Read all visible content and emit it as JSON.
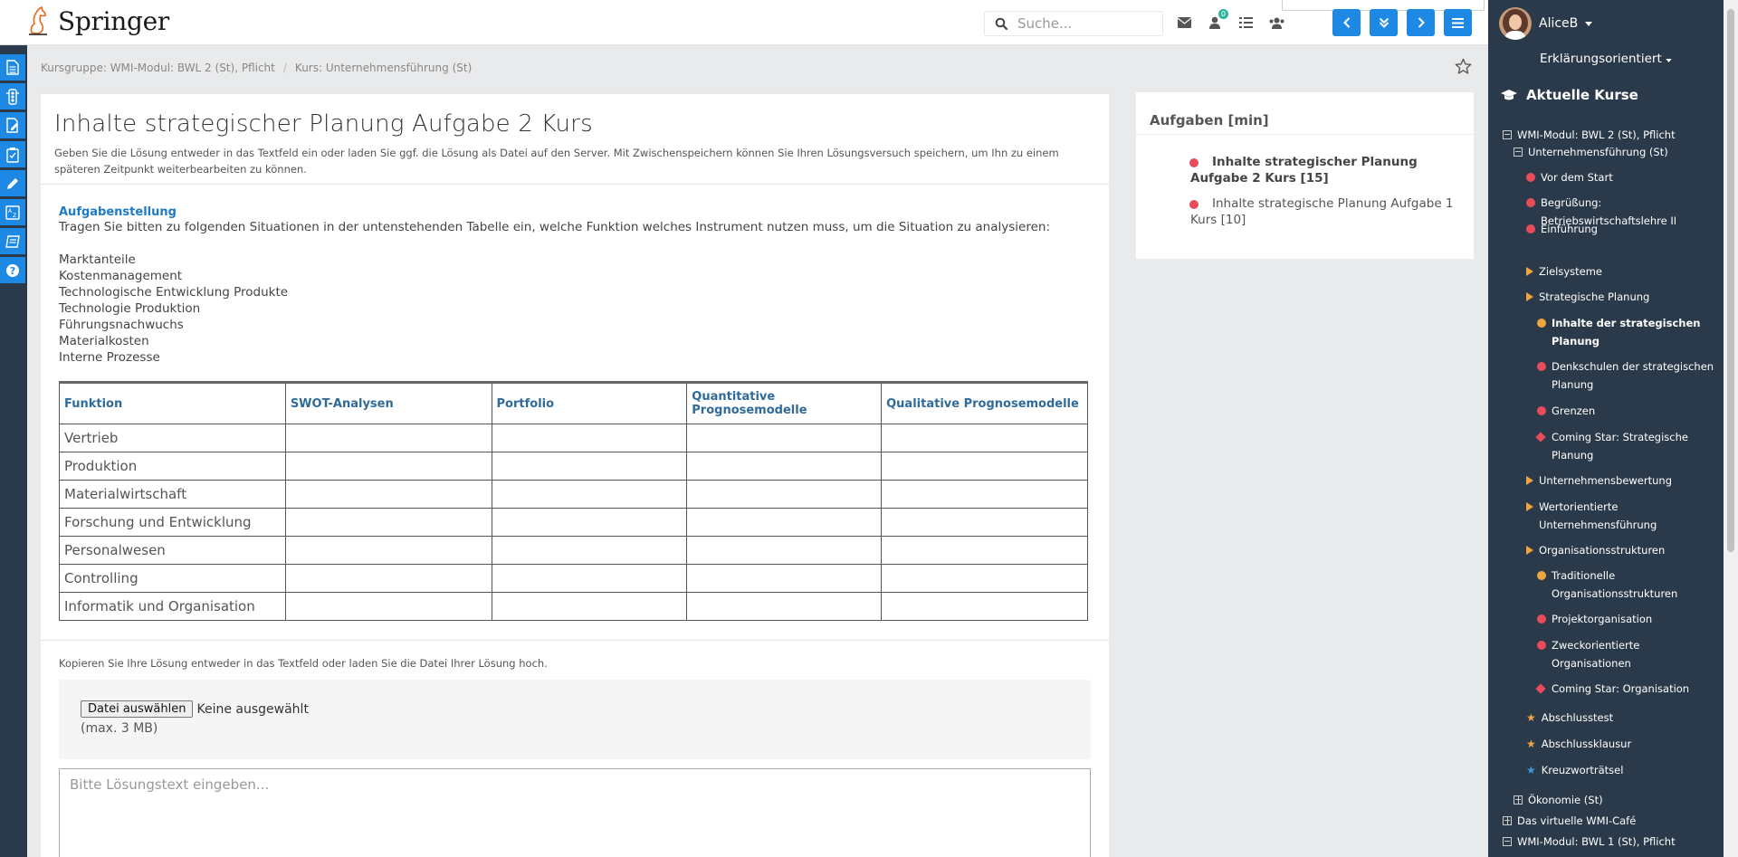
{
  "header": {
    "brand": "Springer",
    "search_placeholder": "Suche...",
    "notification_count": "0"
  },
  "user": {
    "name": "AliceB"
  },
  "mode_selector": {
    "label": "Erklärungsorientiert"
  },
  "breadcrumb": {
    "group": "Kursgruppe: WMI-Modul: BWL 2 (St), Pflicht",
    "course": "Kurs: Unternehmensführung (St)"
  },
  "task": {
    "title": "Inhalte strategischer Planung Aufgabe 2 Kurs",
    "description": "Geben Sie die Lösung entweder in das Textfeld ein oder laden Sie ggf. die Lösung als Datei auf den Server. Mit Zwischenspeichern können Sie Ihren Lösungsversuch speichern, um Ihn zu einem späteren Zeitpunkt weiterbearbeiten zu können.",
    "heading": "Aufgabenstellung",
    "instruction": "Tragen Sie bitten zu folgenden Situationen in der untenstehenden Tabelle ein, welche Funktion welches Instrument nutzen muss, um die Situation zu analysieren:",
    "situations": [
      "Marktanteile",
      "Kostenmanagement",
      "Technologische Entwicklung Produkte",
      "Technologie Produktion",
      "Führungsnachwuchs",
      "Materialkosten",
      "Interne Prozesse"
    ],
    "table": {
      "columns": [
        "Funktion",
        "SWOT-Analysen",
        "Portfolio",
        "Quantitative Prognosemodelle",
        "Qualitative Prognosemodelle"
      ],
      "rows": [
        "Vertrieb",
        "Produktion",
        "Materialwirtschaft",
        "Forschung und Entwicklung",
        "Personalwesen",
        "Controlling",
        "Informatik und Organisation"
      ]
    },
    "upload_note": "Kopieren Sie Ihre Lösung entweder in das Textfeld oder laden Sie die Datei Ihrer Lösung hoch.",
    "file_button": "Datei auswählen",
    "file_status": "Keine ausgewählt",
    "max_size": "(max. 3 MB)",
    "answer_placeholder": "Bitte Lösungstext eingeben..."
  },
  "tasks_panel": {
    "title": "Aufgaben [min]",
    "items": [
      {
        "label": "Inhalte strategischer Planung Aufgabe 2 Kurs [15]",
        "active": true
      },
      {
        "label": "Inhalte strategische Planung Aufgabe 1 Kurs [10]",
        "active": false
      }
    ]
  },
  "sidebar": {
    "heading": "Aktuelle Kurse",
    "items": [
      {
        "label": "WMI-Modul: BWL 2 (St), Pflicht",
        "marker": "box-minus",
        "level": 0
      },
      {
        "label": "Unternehmensführung (St)",
        "marker": "box-minus",
        "level": 1
      },
      {
        "label": "Vor dem Start",
        "marker": "red-dot",
        "level": 2
      },
      {
        "label": "Begrüßung: Betriebswirtschaftslehre II",
        "marker": "red-dot",
        "level": 2
      },
      {
        "label": "Einführung",
        "marker": "red-dot",
        "level": 2
      },
      {
        "label": "Zielsysteme",
        "marker": "triangle",
        "level": 2
      },
      {
        "label": "Strategische Planung",
        "marker": "triangle",
        "level": 2
      },
      {
        "label": "Inhalte der strategischen Planung",
        "marker": "orange-dot",
        "level": 3,
        "active": true
      },
      {
        "label": "Denkschulen der strategischen Planung",
        "marker": "red-dot",
        "level": 3
      },
      {
        "label": "Grenzen",
        "marker": "red-dot",
        "level": 3
      },
      {
        "label": "Coming Star: Strategische Planung",
        "marker": "diamond",
        "level": 3
      },
      {
        "label": "Unternehmensbewertung",
        "marker": "triangle",
        "level": 2
      },
      {
        "label": "Wertorientierte Unternehmensführung",
        "marker": "triangle",
        "level": 2
      },
      {
        "label": "Organisationsstrukturen",
        "marker": "triangle",
        "level": 2
      },
      {
        "label": "Traditionelle Organisationsstrukturen",
        "marker": "orange-dot",
        "level": 3
      },
      {
        "label": "Projektorganisation",
        "marker": "red-dot",
        "level": 3
      },
      {
        "label": "Zweckorientierte Organisationen",
        "marker": "red-dot",
        "level": 3
      },
      {
        "label": "Coming Star: Organisation",
        "marker": "diamond",
        "level": 3
      },
      {
        "label": "Abschlusstest",
        "marker": "star-orange",
        "level": 2
      },
      {
        "label": "Abschlussklausur",
        "marker": "star-orange",
        "level": 2
      },
      {
        "label": "Kreuzworträtsel",
        "marker": "star-blue",
        "level": 2
      },
      {
        "label": "Ökonomie (St)",
        "marker": "box-plus",
        "level": 1
      },
      {
        "label": "Das virtuelle WMI-Café",
        "marker": "box-plus",
        "level": 0
      },
      {
        "label": "WMI-Modul: BWL 1 (St), Pflicht",
        "marker": "box-minus",
        "level": 0
      }
    ]
  },
  "colors": {
    "accent": "#1e88e5",
    "sidebar_bg": "#2b3a4a",
    "link": "#1e7bc5",
    "status_red": "#e84c5b",
    "status_orange": "#f0a640"
  }
}
